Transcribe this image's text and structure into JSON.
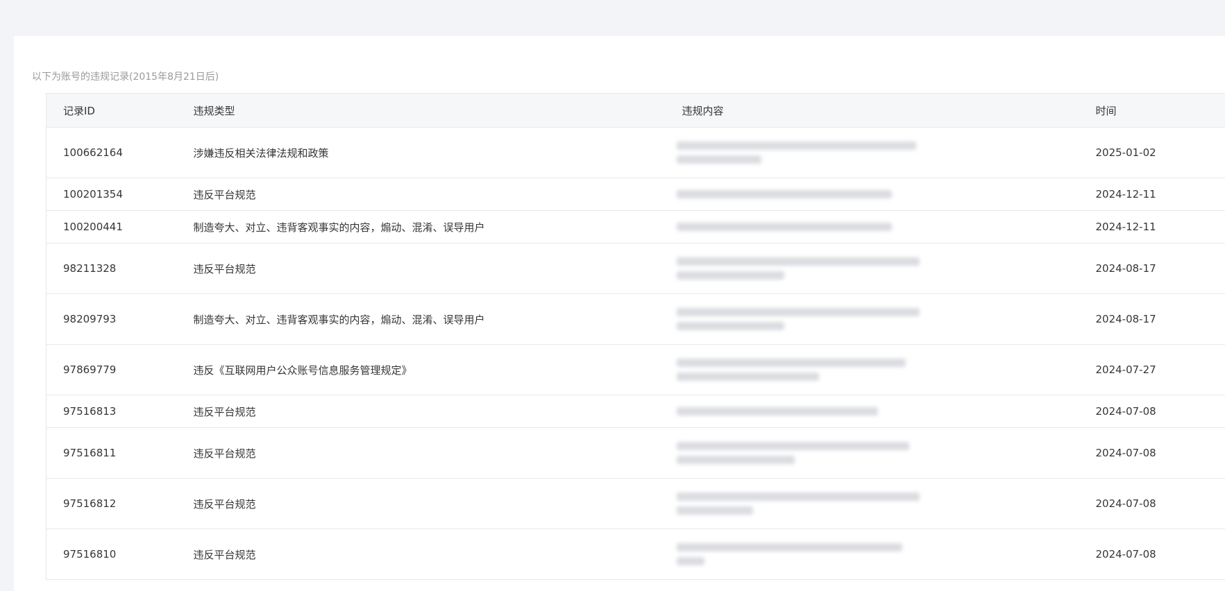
{
  "page": {
    "caption": "以下为账号的违规记录(2015年8月21日后)"
  },
  "table": {
    "columns": [
      "记录ID",
      "违规类型",
      "违规内容",
      "时间"
    ],
    "rows": [
      {
        "id": "100662164",
        "type": "涉嫌违反相关法律法规和政策",
        "time": "2025-01-02"
      },
      {
        "id": "100201354",
        "type": "违反平台规范",
        "time": "2024-12-11"
      },
      {
        "id": "100200441",
        "type": "制造夸大、对立、违背客观事实的内容，煽动、混淆、误导用户",
        "time": "2024-12-11"
      },
      {
        "id": "98211328",
        "type": "违反平台规范",
        "time": "2024-08-17"
      },
      {
        "id": "98209793",
        "type": "制造夸大、对立、违背客观事实的内容，煽动、混淆、误导用户",
        "time": "2024-08-17"
      },
      {
        "id": "97869779",
        "type": "违反《互联网用户公众账号信息服务管理规定》",
        "time": "2024-07-27"
      },
      {
        "id": "97516813",
        "type": "违反平台规范",
        "time": "2024-07-08"
      },
      {
        "id": "97516811",
        "type": "违反平台规范",
        "time": "2024-07-08"
      },
      {
        "id": "97516812",
        "type": "违反平台规范",
        "time": "2024-07-08"
      },
      {
        "id": "97516810",
        "type": "违反平台规范",
        "time": "2024-07-08"
      }
    ]
  },
  "colors": {
    "background": "#f3f4f7",
    "panel": "#ffffff",
    "header_bg": "#f6f7f9",
    "border": "#e7e8eb",
    "caption_text": "#9a9a9a",
    "body_text": "#353535",
    "redacted": "#d6d8dd"
  }
}
